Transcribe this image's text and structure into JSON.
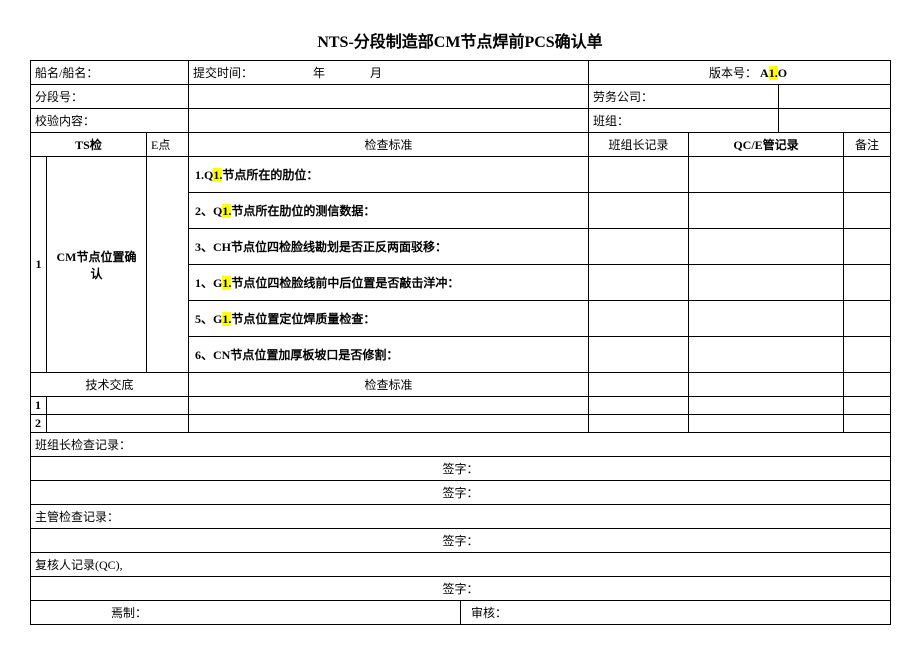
{
  "title": "NTS-分段制造部CM节点焊前PCS确认单",
  "header": {
    "shipLabel": "船名/船名：",
    "submitTimeLabel": "提交时间：",
    "yearLabel": "年",
    "monthLabel": "月",
    "versionLabel": "版本号：",
    "versionPrefix": "A",
    "versionMid": "1.",
    "versionSuffix": "O",
    "sectionLabel": "分段号：",
    "laborLabel": "劳务公司：",
    "inspectLabel": "校验内容：",
    "teamLabel": "班组："
  },
  "columns": {
    "ts": "TS检",
    "epoint": "E点",
    "criteria": "检查标准",
    "teamRecord": "班组长记录",
    "qcRecord": "QC/E管记录",
    "remark": "备注"
  },
  "mainRow": {
    "index": "1",
    "name": "CM节点位置确认"
  },
  "criteria": {
    "c1a": "1.Q",
    "c1b": "1.",
    "c1c": "节点所在的肋位：",
    "c2a": "2、Q",
    "c2b": "1.",
    "c2c": "节点所在肋位的测信数据：",
    "c3": "3、CH节点位四检脸线勘划是否正反两面驳移：",
    "c4a": "1、G",
    "c4b": "1.",
    "c4c": "节点位四检脸线前中后位置是否敲击洋冲：",
    "c5a": "5、G",
    "c5b": "1.",
    "c5c": "节点位置定位焊质量检查：",
    "c6": "6、CN节点位置加厚板坡口是否修割："
  },
  "tech": {
    "label": "技术交底",
    "criteria": "检查标准",
    "r1": "1",
    "r2": "2"
  },
  "footer": {
    "teamLeaderRecord": "班组长检查记录：",
    "signLabel": "签字：",
    "supervisorRecord": "主管检查记录：",
    "qcRecord": "复核人记录(QC),",
    "preparedBy": "焉制：",
    "reviewedBy": "审核："
  }
}
